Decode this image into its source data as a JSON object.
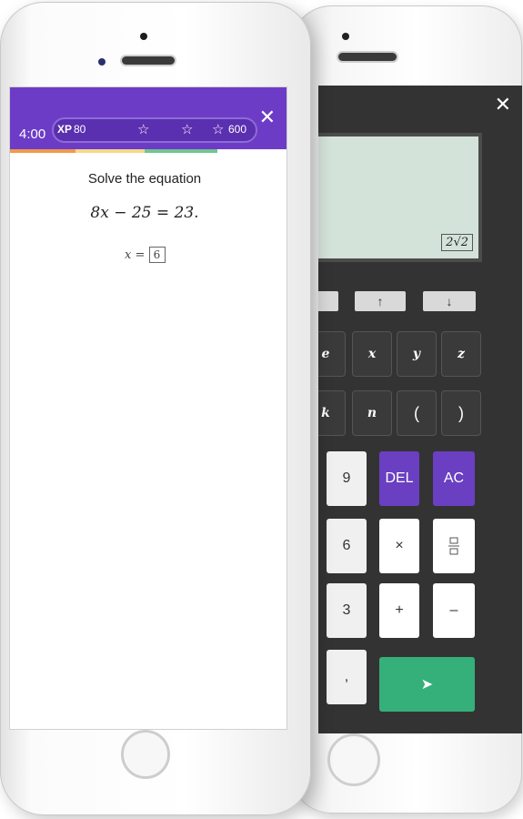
{
  "calculator": {
    "close_icon": "✕",
    "display_result": "2√2",
    "arrow_keys": [
      {
        "id": "left",
        "label": ""
      },
      {
        "id": "up",
        "label": "↑"
      },
      {
        "id": "down",
        "label": "↓"
      }
    ],
    "variable_keys_row1": [
      "e",
      "x",
      "y",
      "z"
    ],
    "variable_keys_row2": [
      "k",
      "n",
      "(",
      ")"
    ],
    "number_rows": [
      [
        "9",
        "DEL",
        "AC"
      ],
      [
        "6",
        "×",
        "fraction"
      ],
      [
        "3",
        "+",
        "–"
      ],
      [
        ",",
        "submit"
      ]
    ],
    "colors": {
      "purple": "#6a3fc1",
      "green": "#35b07b",
      "body": "#333333",
      "display": "#d4e3da"
    }
  },
  "quiz": {
    "timer": "4:00",
    "xp_label": "XP",
    "xp_value": "80",
    "xp_max": "600",
    "question": "Solve the equation",
    "equation": "8x − 25 = 23.",
    "answer_prefix": "x =",
    "answer_value": "6",
    "close_icon": "✕",
    "header_color": "#6c3cc7"
  }
}
